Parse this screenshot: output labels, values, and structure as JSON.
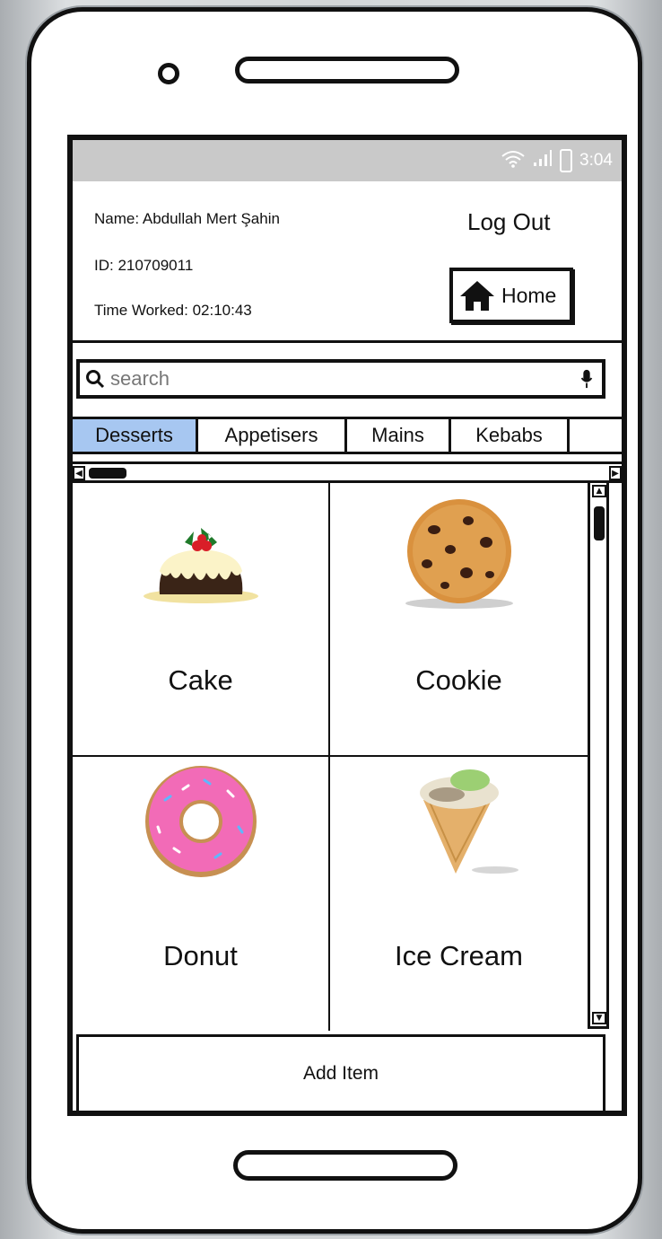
{
  "status_bar": {
    "time": "3:04"
  },
  "header": {
    "name_line": "Name: Abdullah Mert Şahin",
    "id_line": "ID: 210709011",
    "time_line": "Time Worked: 02:10:43",
    "logout_label": "Log Out",
    "home_label": "Home"
  },
  "search": {
    "placeholder": "search",
    "value": ""
  },
  "tabs": [
    {
      "label": "Desserts",
      "active": true
    },
    {
      "label": "Appetisers",
      "active": false
    },
    {
      "label": "Mains",
      "active": false
    },
    {
      "label": "Kebabs",
      "active": false
    }
  ],
  "items": [
    {
      "label": "Cake",
      "icon": "cake-icon"
    },
    {
      "label": "Cookie",
      "icon": "cookie-icon"
    },
    {
      "label": "Donut",
      "icon": "donut-icon"
    },
    {
      "label": "Ice Cream",
      "icon": "ice-cream-icon"
    }
  ],
  "add_item_label": "Add Item",
  "colors": {
    "active_tab": "#a7c7f1",
    "status_bar": "#c9c9c9"
  }
}
